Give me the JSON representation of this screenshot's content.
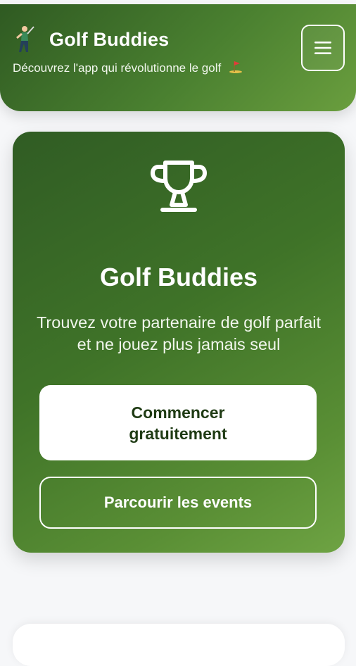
{
  "header": {
    "app_title": "Golf Buddies",
    "tagline": "Découvrez l'app qui révolutionne le golf",
    "logo_icon": "golfer-icon",
    "tagline_icon": "golf-flag-icon",
    "menu_icon": "hamburger-menu-icon"
  },
  "hero": {
    "icon": "trophy-icon",
    "title": "Golf Buddies",
    "subtitle": "Trouvez votre partenaire de golf parfait et ne jouez plus jamais seul",
    "primary_cta": "Commencer gratuitement",
    "secondary_cta": "Parcourir les events"
  },
  "colors": {
    "brand_green_dark": "#2f5a22",
    "brand_green_light": "#6a9e3e",
    "primary_button_bg": "#ffffff",
    "primary_button_text": "#1f3b14"
  }
}
